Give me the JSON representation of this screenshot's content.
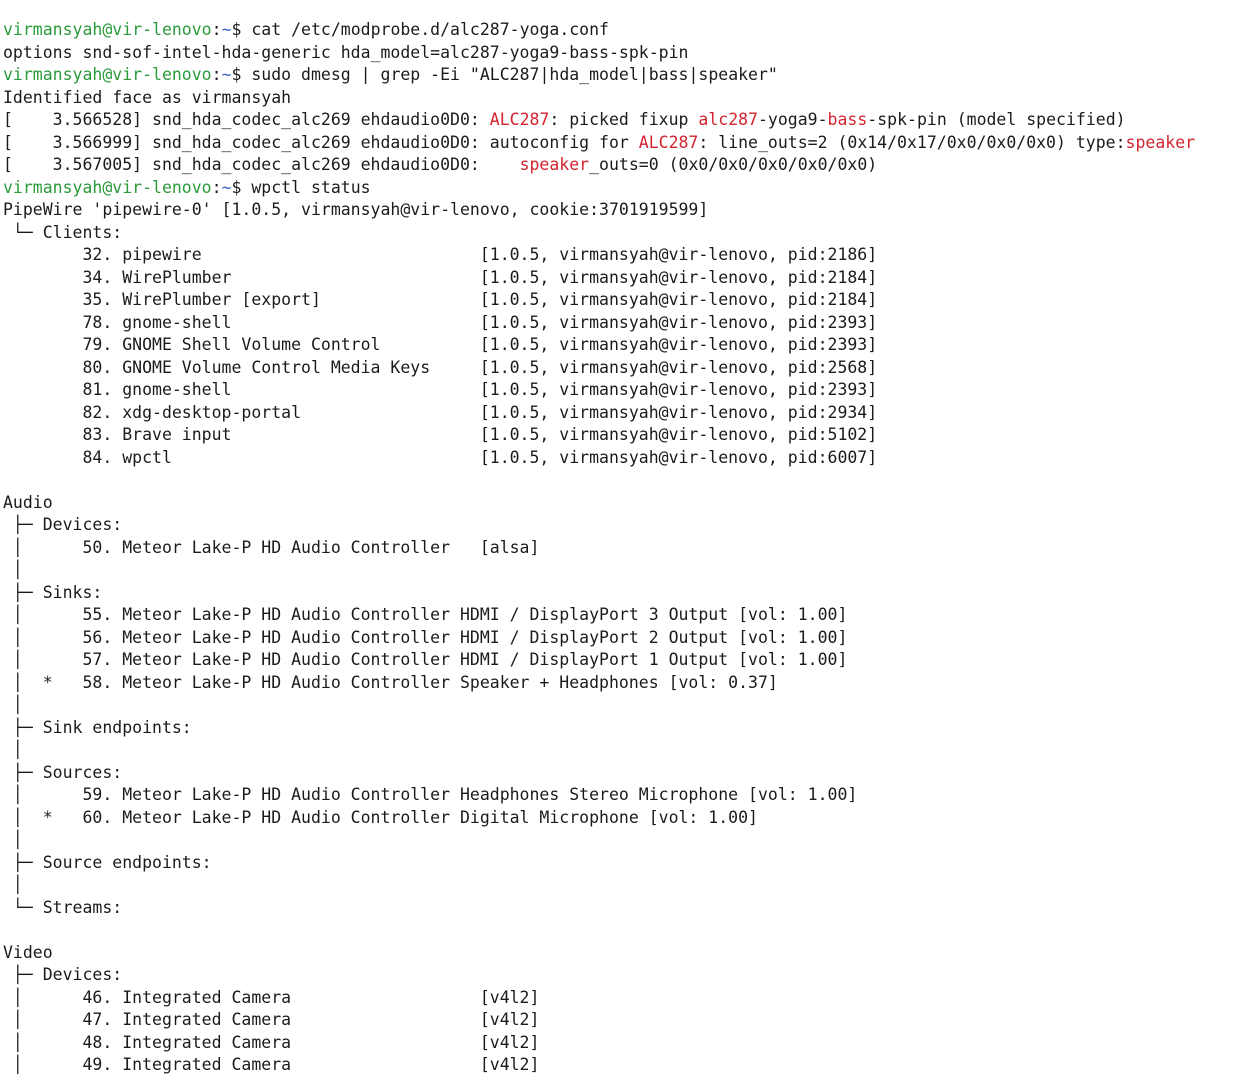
{
  "terminal": {
    "colors": {
      "background": "#ffffff",
      "text": "#1b1b1b",
      "prompt_user": "#2a9a3a",
      "prompt_path": "#3a66c8",
      "highlight": "#d4232f"
    },
    "lines": [
      [
        {
          "t": "virmansyah@vir-lenovo",
          "c": "user"
        },
        {
          "t": ":",
          "c": "plain"
        },
        {
          "t": "~",
          "c": "path"
        },
        {
          "t": "$ cat /etc/modprobe.d/alc287-yoga.conf",
          "c": "plain"
        }
      ],
      [
        {
          "t": "options snd-sof-intel-hda-generic hda_model=alc287-yoga9-bass-spk-pin",
          "c": "plain"
        }
      ],
      [
        {
          "t": "virmansyah@vir-lenovo",
          "c": "user"
        },
        {
          "t": ":",
          "c": "plain"
        },
        {
          "t": "~",
          "c": "path"
        },
        {
          "t": "$ sudo dmesg | grep -Ei \"ALC287|hda_model|bass|speaker\"",
          "c": "plain"
        }
      ],
      [
        {
          "t": "Identified face as virmansyah",
          "c": "plain"
        }
      ],
      [
        {
          "t": "[    3.566528] snd_hda_codec_alc269 ehdaudio0D0: ",
          "c": "plain"
        },
        {
          "t": "ALC287",
          "c": "hl"
        },
        {
          "t": ": picked fixup ",
          "c": "plain"
        },
        {
          "t": "alc287",
          "c": "hl"
        },
        {
          "t": "-yoga9-",
          "c": "plain"
        },
        {
          "t": "bass",
          "c": "hl"
        },
        {
          "t": "-spk-pin (model specified)",
          "c": "plain"
        }
      ],
      [
        {
          "t": "[    3.566999] snd_hda_codec_alc269 ehdaudio0D0: autoconfig for ",
          "c": "plain"
        },
        {
          "t": "ALC287",
          "c": "hl"
        },
        {
          "t": ": line_outs=2 (0x14/0x17/0x0/0x0/0x0) type:",
          "c": "plain"
        },
        {
          "t": "speaker",
          "c": "hl"
        }
      ],
      [
        {
          "t": "[    3.567005] snd_hda_codec_alc269 ehdaudio0D0:    ",
          "c": "plain"
        },
        {
          "t": "speaker",
          "c": "hl"
        },
        {
          "t": "_outs=0 (0x0/0x0/0x0/0x0/0x0)",
          "c": "plain"
        }
      ],
      [
        {
          "t": "virmansyah@vir-lenovo",
          "c": "user"
        },
        {
          "t": ":",
          "c": "plain"
        },
        {
          "t": "~",
          "c": "path"
        },
        {
          "t": "$ wpctl status",
          "c": "plain"
        }
      ],
      [
        {
          "t": "PipeWire 'pipewire-0' [1.0.5, virmansyah@vir-lenovo, cookie:3701919599]",
          "c": "plain"
        }
      ],
      [
        {
          "t": " └─ Clients:",
          "c": "plain"
        }
      ],
      [
        {
          "t": "        32. pipewire                            [1.0.5, virmansyah@vir-lenovo, pid:2186]",
          "c": "plain"
        }
      ],
      [
        {
          "t": "        34. WirePlumber                         [1.0.5, virmansyah@vir-lenovo, pid:2184]",
          "c": "plain"
        }
      ],
      [
        {
          "t": "        35. WirePlumber [export]                [1.0.5, virmansyah@vir-lenovo, pid:2184]",
          "c": "plain"
        }
      ],
      [
        {
          "t": "        78. gnome-shell                         [1.0.5, virmansyah@vir-lenovo, pid:2393]",
          "c": "plain"
        }
      ],
      [
        {
          "t": "        79. GNOME Shell Volume Control          [1.0.5, virmansyah@vir-lenovo, pid:2393]",
          "c": "plain"
        }
      ],
      [
        {
          "t": "        80. GNOME Volume Control Media Keys     [1.0.5, virmansyah@vir-lenovo, pid:2568]",
          "c": "plain"
        }
      ],
      [
        {
          "t": "        81. gnome-shell                         [1.0.5, virmansyah@vir-lenovo, pid:2393]",
          "c": "plain"
        }
      ],
      [
        {
          "t": "        82. xdg-desktop-portal                  [1.0.5, virmansyah@vir-lenovo, pid:2934]",
          "c": "plain"
        }
      ],
      [
        {
          "t": "        83. Brave input                         [1.0.5, virmansyah@vir-lenovo, pid:5102]",
          "c": "plain"
        }
      ],
      [
        {
          "t": "        84. wpctl                               [1.0.5, virmansyah@vir-lenovo, pid:6007]",
          "c": "plain"
        }
      ],
      [
        {
          "t": "",
          "c": "plain"
        }
      ],
      [
        {
          "t": "Audio",
          "c": "plain"
        }
      ],
      [
        {
          "t": " ├─ Devices:",
          "c": "plain"
        }
      ],
      [
        {
          "t": " │      50. Meteor Lake-P HD Audio Controller   [alsa]",
          "c": "plain"
        }
      ],
      [
        {
          "t": " │",
          "c": "plain"
        }
      ],
      [
        {
          "t": " ├─ Sinks:",
          "c": "plain"
        }
      ],
      [
        {
          "t": " │      55. Meteor Lake-P HD Audio Controller HDMI / DisplayPort 3 Output [vol: 1.00]",
          "c": "plain"
        }
      ],
      [
        {
          "t": " │      56. Meteor Lake-P HD Audio Controller HDMI / DisplayPort 2 Output [vol: 1.00]",
          "c": "plain"
        }
      ],
      [
        {
          "t": " │      57. Meteor Lake-P HD Audio Controller HDMI / DisplayPort 1 Output [vol: 1.00]",
          "c": "plain"
        }
      ],
      [
        {
          "t": " │  *   58. Meteor Lake-P HD Audio Controller Speaker + Headphones [vol: 0.37]",
          "c": "plain"
        }
      ],
      [
        {
          "t": " │",
          "c": "plain"
        }
      ],
      [
        {
          "t": " ├─ Sink endpoints:",
          "c": "plain"
        }
      ],
      [
        {
          "t": " │",
          "c": "plain"
        }
      ],
      [
        {
          "t": " ├─ Sources:",
          "c": "plain"
        }
      ],
      [
        {
          "t": " │      59. Meteor Lake-P HD Audio Controller Headphones Stereo Microphone [vol: 1.00]",
          "c": "plain"
        }
      ],
      [
        {
          "t": " │  *   60. Meteor Lake-P HD Audio Controller Digital Microphone [vol: 1.00]",
          "c": "plain"
        }
      ],
      [
        {
          "t": " │",
          "c": "plain"
        }
      ],
      [
        {
          "t": " ├─ Source endpoints:",
          "c": "plain"
        }
      ],
      [
        {
          "t": " │",
          "c": "plain"
        }
      ],
      [
        {
          "t": " └─ Streams:",
          "c": "plain"
        }
      ],
      [
        {
          "t": "",
          "c": "plain"
        }
      ],
      [
        {
          "t": "Video",
          "c": "plain"
        }
      ],
      [
        {
          "t": " ├─ Devices:",
          "c": "plain"
        }
      ],
      [
        {
          "t": " │      46. Integrated Camera                   [v4l2]",
          "c": "plain"
        }
      ],
      [
        {
          "t": " │      47. Integrated Camera                   [v4l2]",
          "c": "plain"
        }
      ],
      [
        {
          "t": " │      48. Integrated Camera                   [v4l2]",
          "c": "plain"
        }
      ],
      [
        {
          "t": " │      49. Integrated Camera                   [v4l2]",
          "c": "plain"
        }
      ]
    ]
  }
}
